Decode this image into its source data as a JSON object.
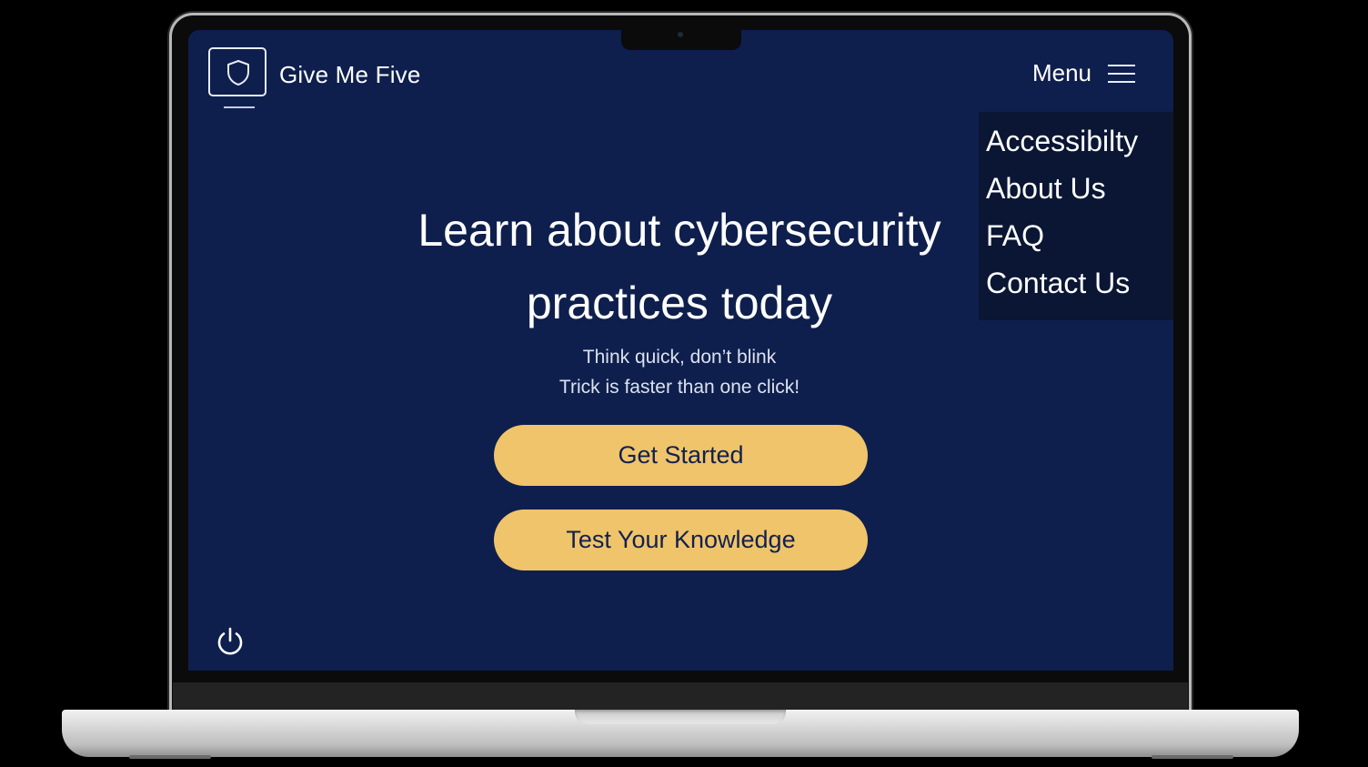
{
  "header": {
    "brand_name": "Give Me Five",
    "logo_icon": "shield-monitor-icon",
    "menu_label": "Menu",
    "menu_icon": "hamburger-icon"
  },
  "menu": {
    "items": [
      {
        "label": "Accessibilty"
      },
      {
        "label": "About Us"
      },
      {
        "label": "FAQ"
      },
      {
        "label": "Contact Us"
      }
    ]
  },
  "hero": {
    "title_line1": "Learn about cybersecurity",
    "title_line2": "practices today",
    "tagline_line1": "Think quick, don’t blink",
    "tagline_line2": "Trick is faster than one click!"
  },
  "actions": {
    "get_started_label": "Get Started",
    "test_knowledge_label": "Test Your Knowledge"
  },
  "footer": {
    "power_icon": "power-icon"
  },
  "colors": {
    "screen_background": "#0e1f4d",
    "menu_background": "#0a1633",
    "button_background": "#f0c46a",
    "button_text": "#11214f",
    "text_primary": "#ffffff"
  }
}
